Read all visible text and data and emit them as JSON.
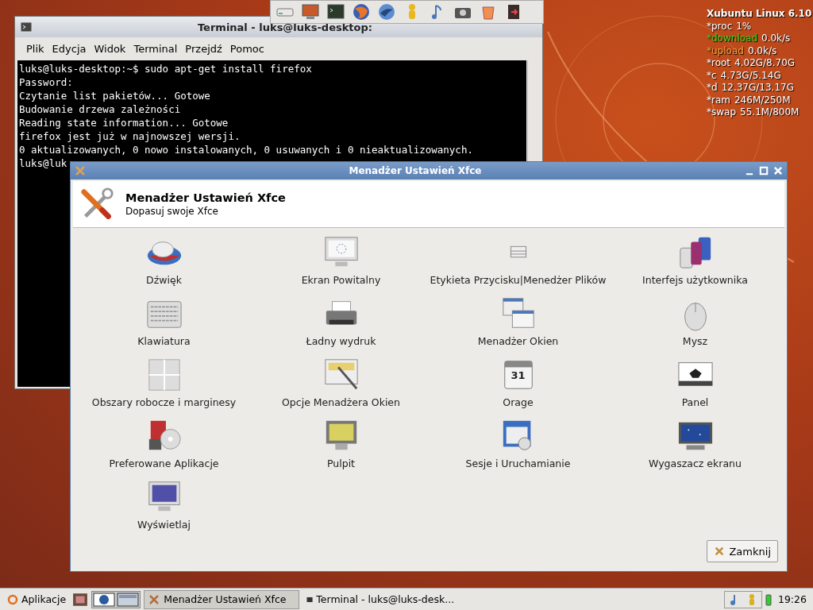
{
  "terminal": {
    "title": "Terminal - luks@luks-desktop:",
    "menu": [
      "Plik",
      "Edycja",
      "Widok",
      "Terminal",
      "Przejdź",
      "Pomoc"
    ],
    "lines": [
      "luks@luks-desktop:~$ sudo apt-get install firefox",
      "Password:",
      "Czytanie list pakietów... Gotowe",
      "Budowanie drzewa zależności",
      "Reading state information... Gotowe",
      "firefox jest już w najnowszej wersji.",
      "0 aktualizowanych, 0 nowo instalowanych, 0 usuwanych i 0 nieaktualizowanych.",
      "luks@luk"
    ]
  },
  "conky": {
    "title": "Xubuntu Linux 6.10",
    "stats": [
      {
        "label": "*proc",
        "value": "1%",
        "color": "#ffffff"
      },
      {
        "label": "*download",
        "value": "0.0k/s",
        "color": "#44cc22"
      },
      {
        "label": "*upload",
        "value": "0.0k/s",
        "color": "#f0a040"
      },
      {
        "label": "*root",
        "value": "4.02G/8.70G",
        "color": "#ffffff"
      },
      {
        "label": "*c",
        "value": "4.73G/5.14G",
        "color": "#ffffff"
      },
      {
        "label": "*d",
        "value": "12.37G/13.17G",
        "color": "#ffffff"
      },
      {
        "label": "*ram",
        "value": "246M/250M",
        "color": "#ffffff"
      },
      {
        "label": "*swap",
        "value": "55.1M/800M",
        "color": "#ffffff"
      }
    ]
  },
  "settings": {
    "title": "Menadżer Ustawień Xfce",
    "heading": "Menadżer Ustawień Xfce",
    "subtitle": "Dopasuj swoje Xfce",
    "items": [
      {
        "label": "Dźwięk"
      },
      {
        "label": "Ekran Powitalny"
      },
      {
        "label": "Etykieta Przycisku|Menedżer Plików"
      },
      {
        "label": "Interfejs użytkownika"
      },
      {
        "label": "Klawiatura"
      },
      {
        "label": "Ładny wydruk"
      },
      {
        "label": "Menadżer Okien"
      },
      {
        "label": "Mysz"
      },
      {
        "label": "Obszary robocze i marginesy"
      },
      {
        "label": "Opcje Menadżera Okien"
      },
      {
        "label": "Orage",
        "badge": "31"
      },
      {
        "label": "Panel"
      },
      {
        "label": "Preferowane Aplikacje"
      },
      {
        "label": "Pulpit"
      },
      {
        "label": "Sesje i Uruchamianie"
      },
      {
        "label": "Wygaszacz ekranu"
      },
      {
        "label": "Wyświetlaj"
      }
    ],
    "close_button": "Zamknij"
  },
  "taskbar": {
    "menu_button": "Aplikacje",
    "tasks": [
      {
        "label": "Menadżer Ustawień Xfce",
        "selected": true
      },
      {
        "label": "Terminal - luks@luks-desk...",
        "selected": false
      }
    ],
    "clock": "19:26"
  }
}
